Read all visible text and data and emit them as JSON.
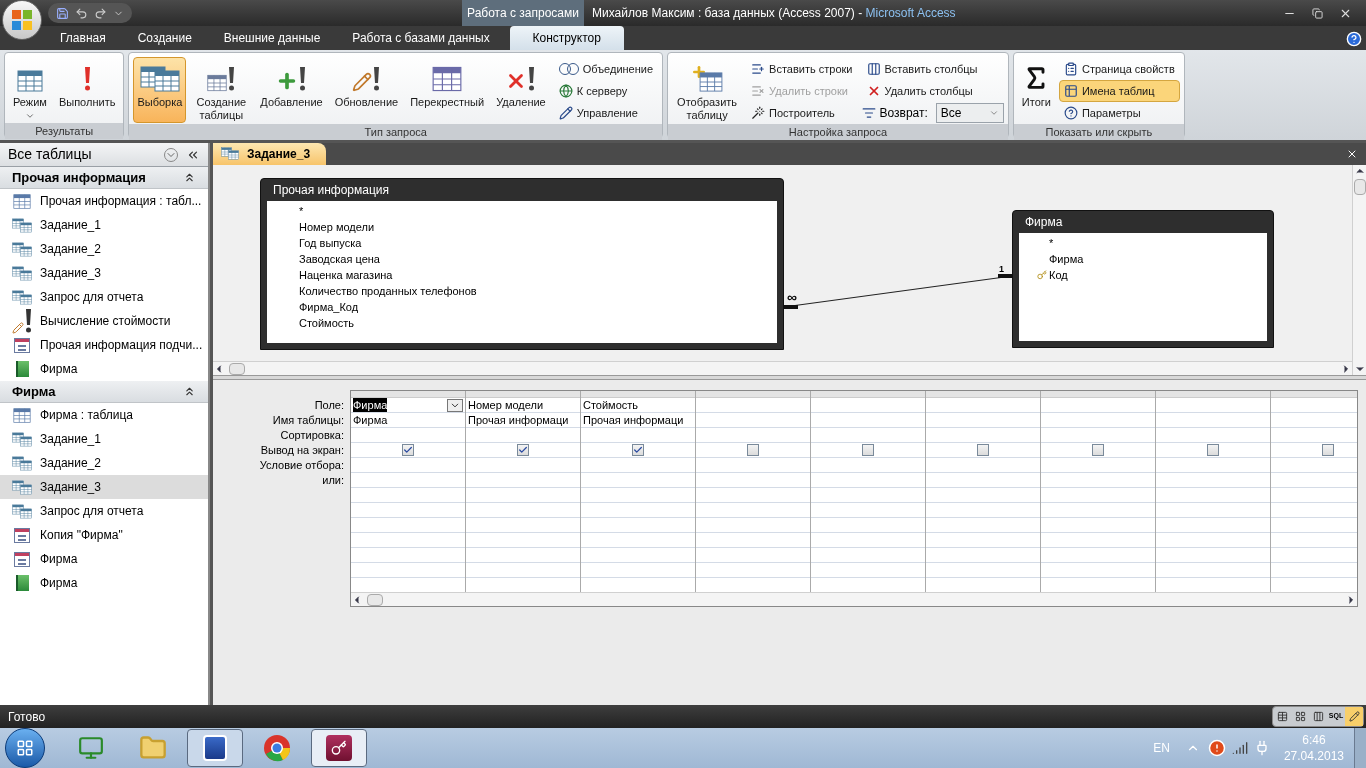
{
  "window": {
    "title": "Михайлов Максим : база данных (Access 2007)",
    "separator": "-",
    "app_name": "Microsoft Access",
    "context_tab": "Работа с запросами"
  },
  "ribbon_tabs": [
    {
      "label": "Главная",
      "selected": false
    },
    {
      "label": "Создание",
      "selected": false
    },
    {
      "label": "Внешние данные",
      "selected": false
    },
    {
      "label": "Работа с базами данных",
      "selected": false
    },
    {
      "label": "Конструктор",
      "selected": true
    }
  ],
  "ribbon_groups": [
    {
      "label": "Результаты",
      "large": [
        {
          "label": "Режим",
          "dropdown": true,
          "selected": false
        },
        {
          "label": "Выполнить",
          "dropdown": false,
          "selected": false
        }
      ]
    },
    {
      "label": "Тип запроса",
      "large": [
        {
          "label": "Выборка",
          "dropdown": false,
          "selected": true
        },
        {
          "label": "Создание таблицы",
          "dropdown": false,
          "selected": false
        },
        {
          "label": "Добавление",
          "dropdown": false,
          "selected": false
        },
        {
          "label": "Обновление",
          "dropdown": false,
          "selected": false
        },
        {
          "label": "Перекрестный",
          "dropdown": false,
          "selected": false
        },
        {
          "label": "Удаление",
          "dropdown": false,
          "selected": false
        }
      ],
      "small": [
        {
          "kind": "button",
          "label": "Объединение",
          "selected": false,
          "disabled": false
        },
        {
          "kind": "button",
          "label": "К серверу",
          "selected": false,
          "disabled": false
        },
        {
          "kind": "button",
          "label": "Управление",
          "selected": false,
          "disabled": false
        }
      ]
    },
    {
      "label": "Настройка запроса",
      "large": [
        {
          "label": "Отобразить таблицу",
          "dropdown": false,
          "selected": false
        }
      ],
      "small": [
        {
          "kind": "button",
          "label": "Вставить строки",
          "selected": false,
          "disabled": false
        },
        {
          "kind": "button",
          "label": "Удалить строки",
          "selected": false,
          "disabled": true
        },
        {
          "kind": "button",
          "label": "Построитель",
          "selected": false,
          "disabled": false
        },
        {
          "kind": "button",
          "label": "Вставить столбцы",
          "selected": false,
          "disabled": false
        },
        {
          "kind": "button",
          "label": "Удалить столбцы",
          "selected": false,
          "disabled": false
        },
        {
          "kind": "combo",
          "label": "Возврат:",
          "value": "Все"
        }
      ]
    },
    {
      "label": "Показать или скрыть",
      "large": [
        {
          "label": "Итоги",
          "dropdown": false,
          "selected": false
        }
      ],
      "small": [
        {
          "kind": "button",
          "label": "Страница свойств",
          "selected": false,
          "disabled": false
        },
        {
          "kind": "button",
          "label": "Имена таблиц",
          "selected": true,
          "disabled": false
        },
        {
          "kind": "button",
          "label": "Параметры",
          "selected": false,
          "disabled": false
        }
      ]
    }
  ],
  "nav": {
    "title": "Все таблицы",
    "groups": [
      {
        "title": "Прочая информация",
        "expanded": true,
        "items": [
          {
            "label": "Прочая информация : табл...",
            "kind": "table",
            "selected": false
          },
          {
            "label": "Задание_1",
            "kind": "query",
            "selected": false
          },
          {
            "label": "Задание_2",
            "kind": "query",
            "selected": false
          },
          {
            "label": "Задание_3",
            "kind": "query",
            "selected": false
          },
          {
            "label": "Запрос для отчета",
            "kind": "query",
            "selected": false
          },
          {
            "label": "Вычисление стоймости",
            "kind": "update_query",
            "selected": false
          },
          {
            "label": "Прочая информация подчи...",
            "kind": "form",
            "selected": false
          },
          {
            "label": "Фирма",
            "kind": "report",
            "selected": false
          }
        ]
      },
      {
        "title": "Фирма",
        "expanded": true,
        "items": [
          {
            "label": "Фирма : таблица",
            "kind": "table",
            "selected": false
          },
          {
            "label": "Задание_1",
            "kind": "query",
            "selected": false
          },
          {
            "label": "Задание_2",
            "kind": "query",
            "selected": false
          },
          {
            "label": "Задание_3",
            "kind": "query",
            "selected": true
          },
          {
            "label": "Запрос для отчета",
            "kind": "query",
            "selected": false
          },
          {
            "label": "Копия \"Фирма\"",
            "kind": "form",
            "selected": false
          },
          {
            "label": "Фирма",
            "kind": "form",
            "selected": false
          },
          {
            "label": "Фирма",
            "kind": "report",
            "selected": false
          }
        ]
      }
    ]
  },
  "doc_tab": {
    "label": "Задание_3",
    "selected": true
  },
  "design": {
    "tables": [
      {
        "title": "Прочая информация",
        "fields": [
          {
            "name": "*",
            "primary_key": false
          },
          {
            "name": "Номер модели",
            "primary_key": false
          },
          {
            "name": "Год выпуска",
            "primary_key": false
          },
          {
            "name": "Заводская цена",
            "primary_key": false
          },
          {
            "name": "Наценка магазина",
            "primary_key": false
          },
          {
            "name": "Количество проданных телефонов",
            "primary_key": false
          },
          {
            "name": "Фирма_Код",
            "primary_key": false
          },
          {
            "name": "Стоймость",
            "primary_key": false
          }
        ]
      },
      {
        "title": "Фирма",
        "fields": [
          {
            "name": "*",
            "primary_key": false
          },
          {
            "name": "Фирма",
            "primary_key": false
          },
          {
            "name": "Код",
            "primary_key": true
          }
        ]
      }
    ],
    "relationship": {
      "many_label": "∞",
      "one_label": "1"
    }
  },
  "grid": {
    "row_labels": [
      "Поле:",
      "Имя таблицы:",
      "Сортировка:",
      "Вывод на экран:",
      "Условие отбора:",
      "или:"
    ],
    "columns": [
      {
        "field": "Фирма",
        "table": "Фирма",
        "show": true,
        "selected": true
      },
      {
        "field": "Номер модели",
        "table": "Прочая информаци",
        "show": true,
        "selected": false
      },
      {
        "field": "Стоймость",
        "table": "Прочая информаци",
        "show": true,
        "selected": false
      },
      {
        "show": false,
        "selected": false
      },
      {
        "show": false,
        "selected": false
      },
      {
        "show": false,
        "selected": false
      },
      {
        "show": false,
        "selected": false
      },
      {
        "show": false,
        "selected": false
      },
      {
        "show": false,
        "selected": false
      }
    ]
  },
  "status": {
    "text": "Готово",
    "views": [
      {
        "selected": false
      },
      {
        "selected": false
      },
      {
        "selected": false
      },
      {
        "label": "SQL",
        "selected": false
      },
      {
        "selected": true
      }
    ]
  },
  "taskbar": {
    "apps": [
      {
        "open": false,
        "selected": false
      },
      {
        "open": false,
        "selected": false
      },
      {
        "open": true,
        "selected": false
      },
      {
        "open": false,
        "selected": false
      },
      {
        "open": true,
        "selected": true
      }
    ],
    "language": "EN",
    "time": "6:46",
    "date": "27.04.2013"
  }
}
